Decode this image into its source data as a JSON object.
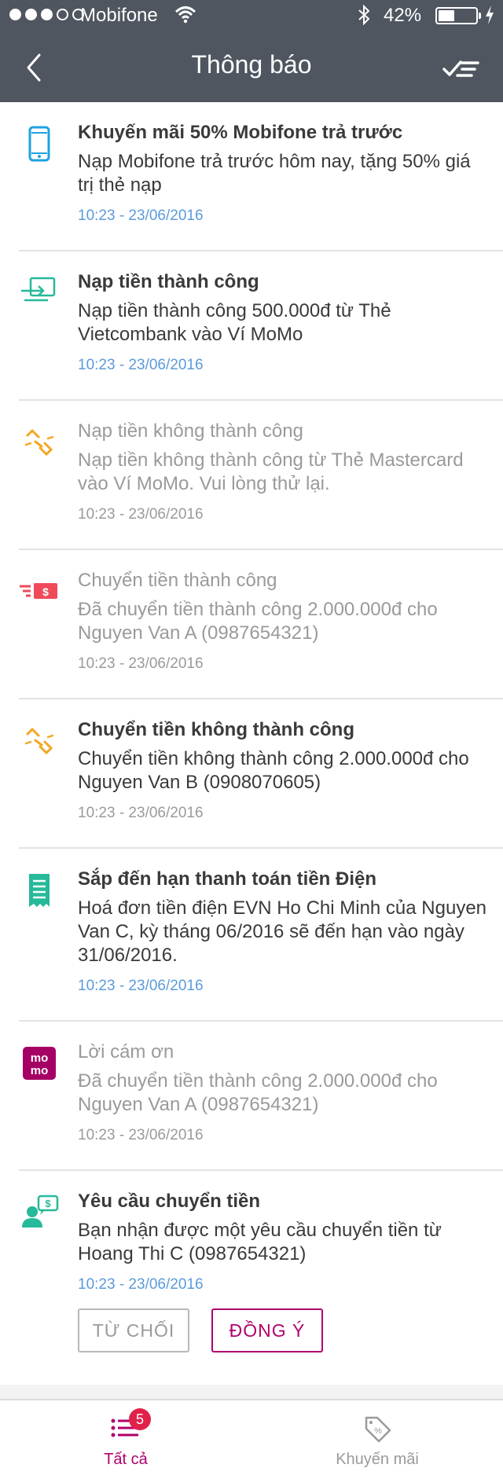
{
  "status_bar": {
    "carrier": "Mobifone",
    "battery": "42%",
    "signal_level": 3
  },
  "nav": {
    "title": "Thông báo"
  },
  "colors": {
    "header": "#4f5660",
    "accent": "#b0006d",
    "time_blue": "#5b9bd9",
    "badge": "#e0224b"
  },
  "notifications": [
    {
      "icon": "phone-icon",
      "title": "Khuyến mãi 50% Mobifone trả trước",
      "body": "Nạp Mobifone trả trước hôm nay, tặng 50% giá trị thẻ nạp",
      "time": "10:23 - 23/06/2016"
    },
    {
      "icon": "card-deposit-icon",
      "title": "Nạp tiền thành công",
      "body": "Nạp tiền thành công 500.000đ từ Thẻ Vietcombank vào Ví MoMo",
      "time": "10:23 - 23/06/2016"
    },
    {
      "icon": "broken-link-icon",
      "title": "Nạp tiền không thành công",
      "body": "Nạp tiền không thành công từ Thẻ Mastercard vào Ví MoMo. Vui lòng thử lại.",
      "time": "10:23 - 23/06/2016"
    },
    {
      "icon": "money-transfer-icon",
      "title": "Chuyển tiền thành công",
      "body": "Đã chuyển tiền thành công 2.000.000đ cho Nguyen Van A (0987654321)",
      "time": "10:23 - 23/06/2016"
    },
    {
      "icon": "broken-link-icon",
      "title": "Chuyển tiền không thành công",
      "body": "Chuyển tiền không thành công 2.000.000đ cho Nguyen Van B (0908070605)",
      "time": "10:23 - 23/06/2016"
    },
    {
      "icon": "bill-icon",
      "title": "Sắp đến hạn thanh toán tiền Điện",
      "body": "Hoá đơn tiền điện EVN Ho Chi Minh của Nguyen Van C, kỳ tháng 06/2016 sẽ đến hạn vào ngày 31/06/2016.",
      "time": "10:23 - 23/06/2016"
    },
    {
      "icon": "momo-logo-icon",
      "logo_text": "mo mo",
      "title": "Lời cám ơn",
      "body": "Đã chuyển tiền thành công 2.000.000đ cho Nguyen Van A (0987654321)",
      "time": "10:23 - 23/06/2016"
    },
    {
      "icon": "money-request-icon",
      "title": "Yêu cầu chuyển tiền",
      "body": "Bạn nhận được một yêu cầu chuyển tiền từ Hoang Thi C (0987654321)",
      "time": "10:23 - 23/06/2016",
      "decline_label": "TỪ CHỐI",
      "accept_label": "ĐỒNG Ý"
    }
  ],
  "tabs": {
    "all_label": "Tất cả",
    "all_badge": "5",
    "promo_label": "Khuyến mãi"
  }
}
